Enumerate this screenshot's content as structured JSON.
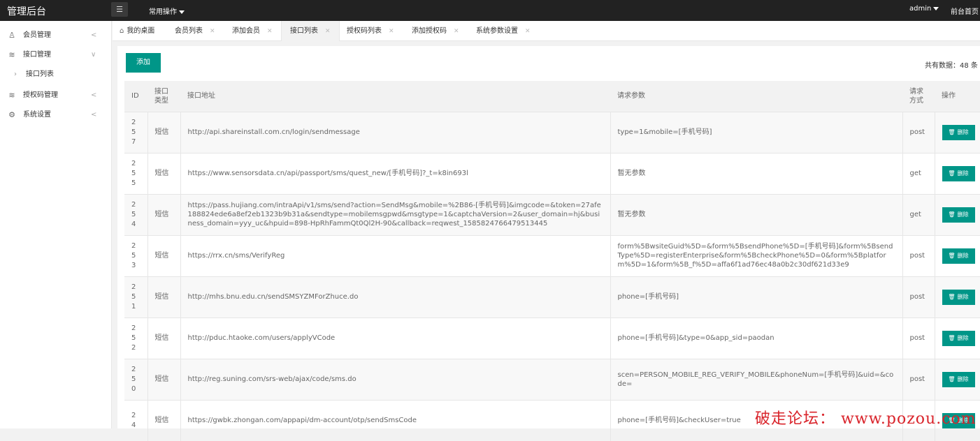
{
  "topbar": {
    "brand": "管理后台",
    "menu_icon": "list-icon",
    "common_ops": "常用操作",
    "admin": "admin",
    "front_home": "前台首页"
  },
  "sidebar": {
    "items": [
      {
        "icon": "user-icon",
        "label": "会员管理",
        "chevron": "<"
      },
      {
        "icon": "database-icon",
        "label": "接口管理",
        "chevron": "∨"
      },
      {
        "icon": "database-icon",
        "label": "授权码管理",
        "chevron": "<"
      },
      {
        "icon": "gear-icon",
        "label": "系统设置",
        "chevron": "<"
      }
    ],
    "sub_items": [
      {
        "label": "接口列表"
      }
    ]
  },
  "tabs": [
    {
      "label": "我的桌面",
      "closable": false
    },
    {
      "label": "会员列表",
      "closable": true
    },
    {
      "label": "添加会员",
      "closable": true
    },
    {
      "label": "接口列表",
      "closable": true,
      "active": true
    },
    {
      "label": "授权码列表",
      "closable": true
    },
    {
      "label": "添加授权码",
      "closable": true
    },
    {
      "label": "系统参数设置",
      "closable": true
    }
  ],
  "toolbar": {
    "add_label": "添加",
    "total_text": "共有数据：48 条"
  },
  "table": {
    "headers": [
      "ID",
      "接口\n类型",
      "接口地址",
      "请求参数",
      "请求\n方式",
      "操作"
    ],
    "delete_label": "删除",
    "rows": [
      {
        "id": "257",
        "type": "短信",
        "url": "http://api.shareinstall.com.cn/login/sendmessage",
        "params": "type=1&mobile=[手机号码]",
        "method": "post"
      },
      {
        "id": "255",
        "type": "短信",
        "url": "https://www.sensorsdata.cn/api/passport/sms/quest_new/[手机号码]?_t=k8in693l",
        "params": "暂无参数",
        "method": "get"
      },
      {
        "id": "254",
        "type": "短信",
        "url": "https://pass.hujiang.com/intraApi/v1/sms/send?action=SendMsg&mobile=%2B86-[手机号码]&imgcode=&token=27afe188824ede6a8ef2eb1323b9b31a&sendtype=mobilemsgpwd&msgtype=1&captchaVersion=2&user_domain=hj&business_domain=yyy_uc&hpuid=898-HpRhFammQt0Ql2H-90&callback=reqwest_1585824766479513445",
        "params": "暂无参数",
        "method": "get"
      },
      {
        "id": "253",
        "type": "短信",
        "url": "https://rrx.cn/sms/VerifyReg",
        "params": "form%5BwsiteGuid%5D=&form%5BsendPhone%5D=[手机号码]&form%5BsendType%5D=registerEnterprise&form%5BcheckPhone%5D=0&form%5Bplatform%5D=1&form%5B_f%5D=affa6f1ad76ec48a0b2c30df621d33e9",
        "method": "post"
      },
      {
        "id": "251",
        "type": "短信",
        "url": "http://mhs.bnu.edu.cn/sendSMSYZMForZhuce.do",
        "params": "phone=[手机号码]",
        "method": "post"
      },
      {
        "id": "252",
        "type": "短信",
        "url": "http://pduc.htaoke.com/users/applyVCode",
        "params": "phone=[手机号码]&type=0&app_sid=paodan",
        "method": "post"
      },
      {
        "id": "250",
        "type": "短信",
        "url": "http://reg.suning.com/srs-web/ajax/code/sms.do",
        "params": "scen=PERSON_MOBILE_REG_VERIFY_MOBILE&phoneNum=[手机号码]&uid=&code=",
        "method": "post"
      },
      {
        "id": "24",
        "type": "短信",
        "url": "https://gwbk.zhongan.com/appapi/dm-account/otp/sendSmsCode",
        "params": "phone=[手机号码]&checkUser=true",
        "method": ""
      }
    ]
  },
  "watermark": "破走论坛： www.pozou.com"
}
